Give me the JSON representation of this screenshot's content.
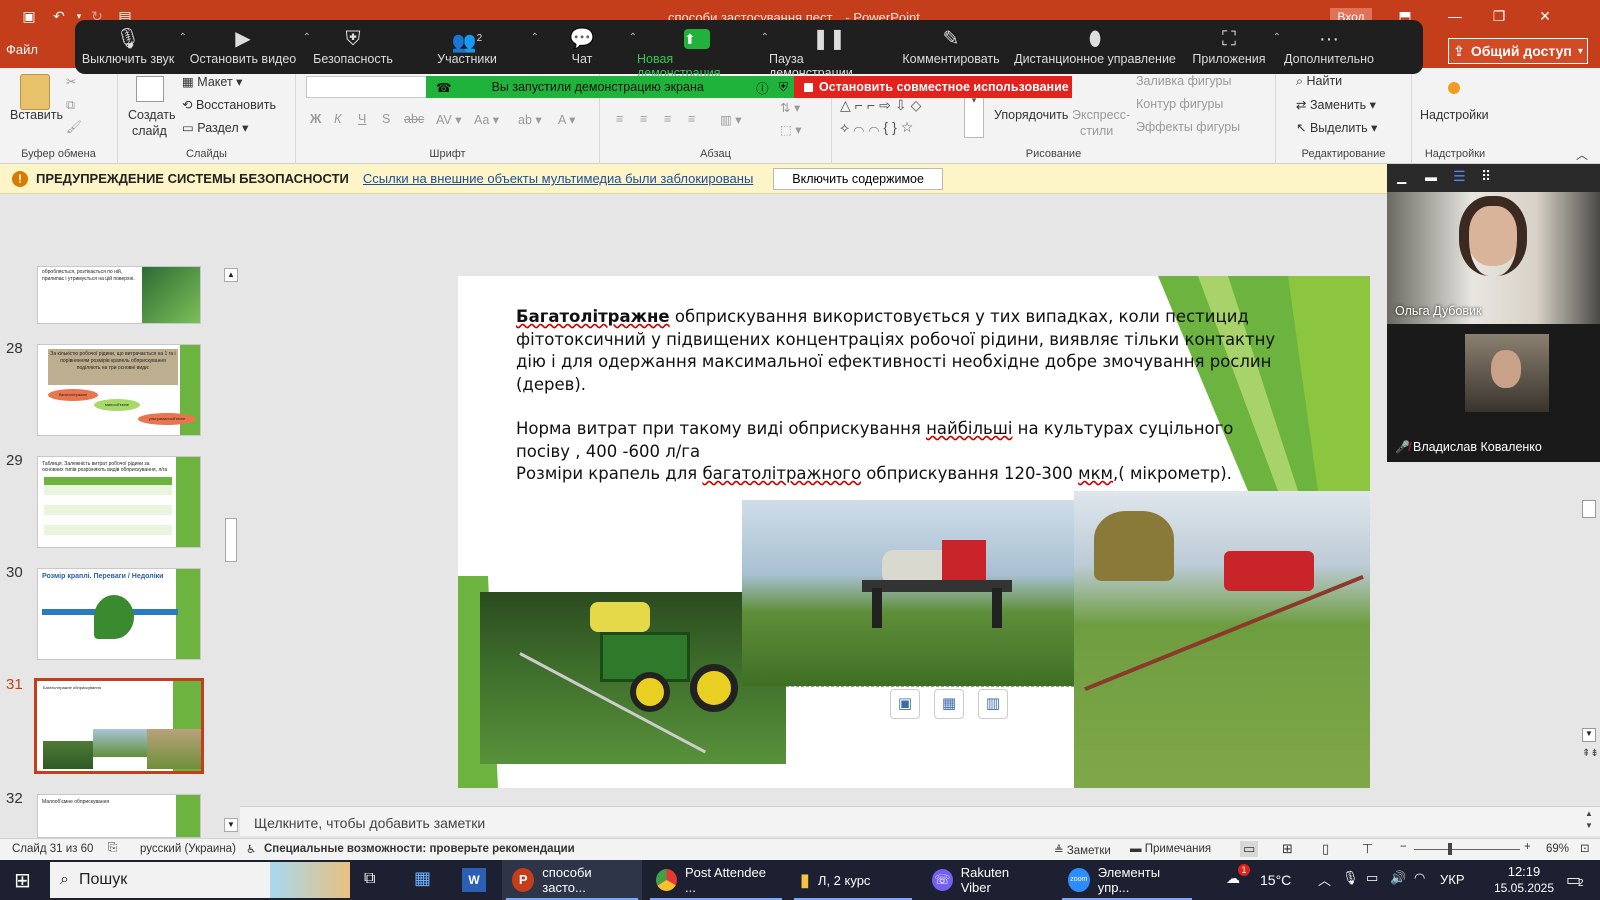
{
  "window": {
    "title": "способи застосування пест... - PowerPoint",
    "signin": "Вход"
  },
  "file_tab": "Файл",
  "share": "Общий доступ",
  "zoom": {
    "buttons": [
      {
        "label": "Выключить звук",
        "icon": "microphone-icon"
      },
      {
        "label": "Остановить видео",
        "icon": "video-camera-icon"
      },
      {
        "label": "Безопасность",
        "icon": "shield-icon"
      },
      {
        "label": "Участники",
        "icon": "participants-icon",
        "count": "2"
      },
      {
        "label": "Чат",
        "icon": "chat-icon"
      },
      {
        "label": "Новая демонстрация",
        "icon": "share-screen-icon"
      },
      {
        "label": "Пауза демонстрации",
        "icon": "pause-icon"
      },
      {
        "label": "Комментировать",
        "icon": "pencil-icon"
      },
      {
        "label": "Дистанционное управление",
        "icon": "mouse-icon"
      },
      {
        "label": "Приложения",
        "icon": "apps-icon"
      },
      {
        "label": "Дополнительно",
        "icon": "more-icon"
      }
    ],
    "sharing_notice": "Вы запустили демонстрацию экрана",
    "stop_share": "Остановить совместное использование"
  },
  "ribbon": {
    "clipboard": {
      "paste": "Вставить",
      "group": "Буфер обмена"
    },
    "slides": {
      "create": "Создать",
      "create2": "слайд",
      "layout": "Макет",
      "reset": "Восстановить",
      "section": "Раздел",
      "group": "Слайды"
    },
    "font": {
      "group": "Шрифт",
      "bold": "Ж",
      "italic": "К",
      "underline": "Ч",
      "strike": "S",
      "abc": "abc"
    },
    "paragraph": {
      "group": "Абзац"
    },
    "drawing": {
      "arrange": "Упорядочить",
      "quick1": "Экспресс-",
      "quick2": "стили",
      "fill": "Заливка фигуры",
      "outline": "Контур фигуры",
      "effects": "Эффекты фигуры",
      "group": "Рисование"
    },
    "editing": {
      "find": "Найти",
      "replace": "Заменить",
      "select": "Выделить",
      "group": "Редактирование"
    },
    "addins": {
      "label": "Надстройки",
      "group": "Надстройки"
    }
  },
  "security": {
    "header": "ПРЕДУПРЕЖДЕНИЕ СИСТЕМЫ БЕЗОПАСНОСТИ",
    "message": "Ссылки на внешние объекты мультимедиа были заблокированы",
    "button": "Включить содержимое"
  },
  "thumbnails": [
    {
      "num": "",
      "text": "обробляється, розтікається по ній, прилипає і утримується на цій поверхні."
    },
    {
      "num": "28",
      "text": "За кількістю робочої рідини, що витрачається на 1 га і порівнянням розмірів крапель обприскування поділяють на три основні види:",
      "ovals": [
        "багатолітражне",
        "малооб'ємне",
        "ультрамалооб'ємне"
      ]
    },
    {
      "num": "29",
      "text": "Таблиця. Залежність витрат робочої рідини за основних типів розрізняють видів обприскування, л/га"
    },
    {
      "num": "30",
      "text": "Розмір краплі. Переваги / Недоліки"
    },
    {
      "num": "31",
      "text": "Багатолітражне обприскування"
    },
    {
      "num": "32",
      "text": "Малооб'ємне обприскування"
    }
  ],
  "slide": {
    "p1_bold": "Багатолітражне",
    "p1_rest": " обприскування використовується у тих випадках, коли пестицид фітотоксичний у підвищених концентраціях робочої рідини, виявляє тільки контактну дію і для одержання максимальної ефективності необхідне добре змочування рослин (дерев).",
    "p2_a": "Норма витрат при такому виді обприскування ",
    "p2_u": "найбільші",
    "p2_b": " на культурах суцільного посіву ,  400 -600 л/га",
    "p3_a": "Розміри крапель для ",
    "p3_u": "багатолітражного",
    "p3_b": " обприскування 120-300 ",
    "p3_u2": "мкм",
    "p3_c": ",( мікрометр)."
  },
  "notes_placeholder": "Щелкните, чтобы добавить заметки",
  "status": {
    "slide": "Слайд 31 из 60",
    "lang": "русский (Украина)",
    "accessibility": "Специальные возможности: проверьте рекомендации",
    "notes": "Заметки",
    "comments": "Примечания",
    "zoom": "69%"
  },
  "video": {
    "p1": "Ольга Дубовик",
    "p2": "Владислав Коваленко"
  },
  "taskbar": {
    "search": "Пошук",
    "apps": [
      "способи засто...",
      "Post Attendee ...",
      "Л, 2 курс",
      "Rakuten Viber",
      "Элементы упр..."
    ],
    "weather": "15°C",
    "lang": "УКР",
    "time": "12:19",
    "date": "15.05.2025",
    "notif": "2"
  },
  "colors": {
    "accent": "#c43e1c",
    "zoom_green": "#1fb33c",
    "stop_red": "#e2221c",
    "slide_green": "#6db33f"
  }
}
